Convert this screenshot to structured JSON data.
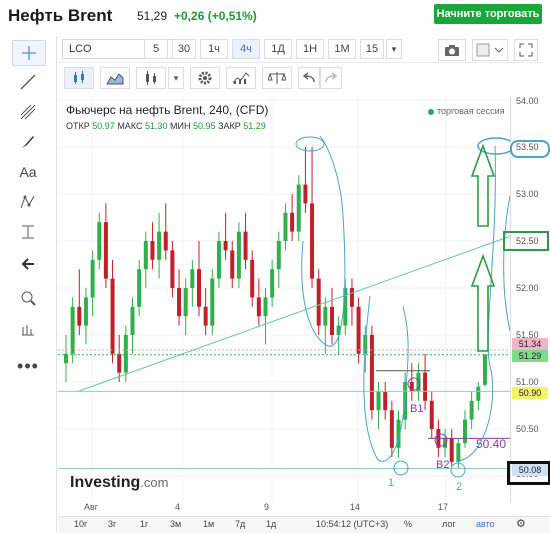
{
  "header": {
    "title": "Нефть Brent",
    "price": "51,29",
    "change": "+0,26 (+0,51%)",
    "trade_button": "Начните торговать"
  },
  "toolbar": {
    "symbol": "LCO",
    "intervals": [
      "5",
      "30",
      "1ч",
      "4ч",
      "1Д",
      "1Н",
      "1М",
      "15"
    ],
    "active_interval": "4ч"
  },
  "chart": {
    "legend_title": "Фьючерс на нефть Brent, 240, (CFD)",
    "legend_open_label": "ОТКР",
    "legend_open": "50.97",
    "legend_high_label": "МАКС",
    "legend_high": "51.30",
    "legend_low_label": "МИН",
    "legend_low": "50.95",
    "legend_close_label": "ЗАКР",
    "legend_close": "51.29",
    "session": "торговая сессия",
    "logo": "Investing",
    "logo_domain": ".com",
    "annotations": {
      "b1": "B1",
      "b2": "B2",
      "n1": "1",
      "n2": "2",
      "level": "50.40"
    }
  },
  "price_axis": {
    "labels": [
      "54.00",
      "53.50",
      "53.00",
      "52.50",
      "52.00",
      "51.50",
      "51.00",
      "50.50",
      "50.00"
    ],
    "tags": [
      "51.34",
      "51.29",
      "50.90",
      "50.08"
    ],
    "tag_colors": [
      "#f3b5c5",
      "#7ddc8c",
      "#f3f36b",
      "#cfe1f5"
    ]
  },
  "time_axis": {
    "labels": [
      "Авг",
      "4",
      "9",
      "14",
      "17"
    ]
  },
  "bottom_bar": {
    "ranges": [
      "10г",
      "3г",
      "1г",
      "3м",
      "1м",
      "7д",
      "1д"
    ],
    "time": "10:54:12 (UTC+3)",
    "percent": "%",
    "log": "лог",
    "auto": "авто"
  },
  "colors": {
    "up": "#2fb04a",
    "down": "#c0202a",
    "annotation_green": "#2e9a46",
    "annotation_blue": "#4ba3c7"
  }
}
